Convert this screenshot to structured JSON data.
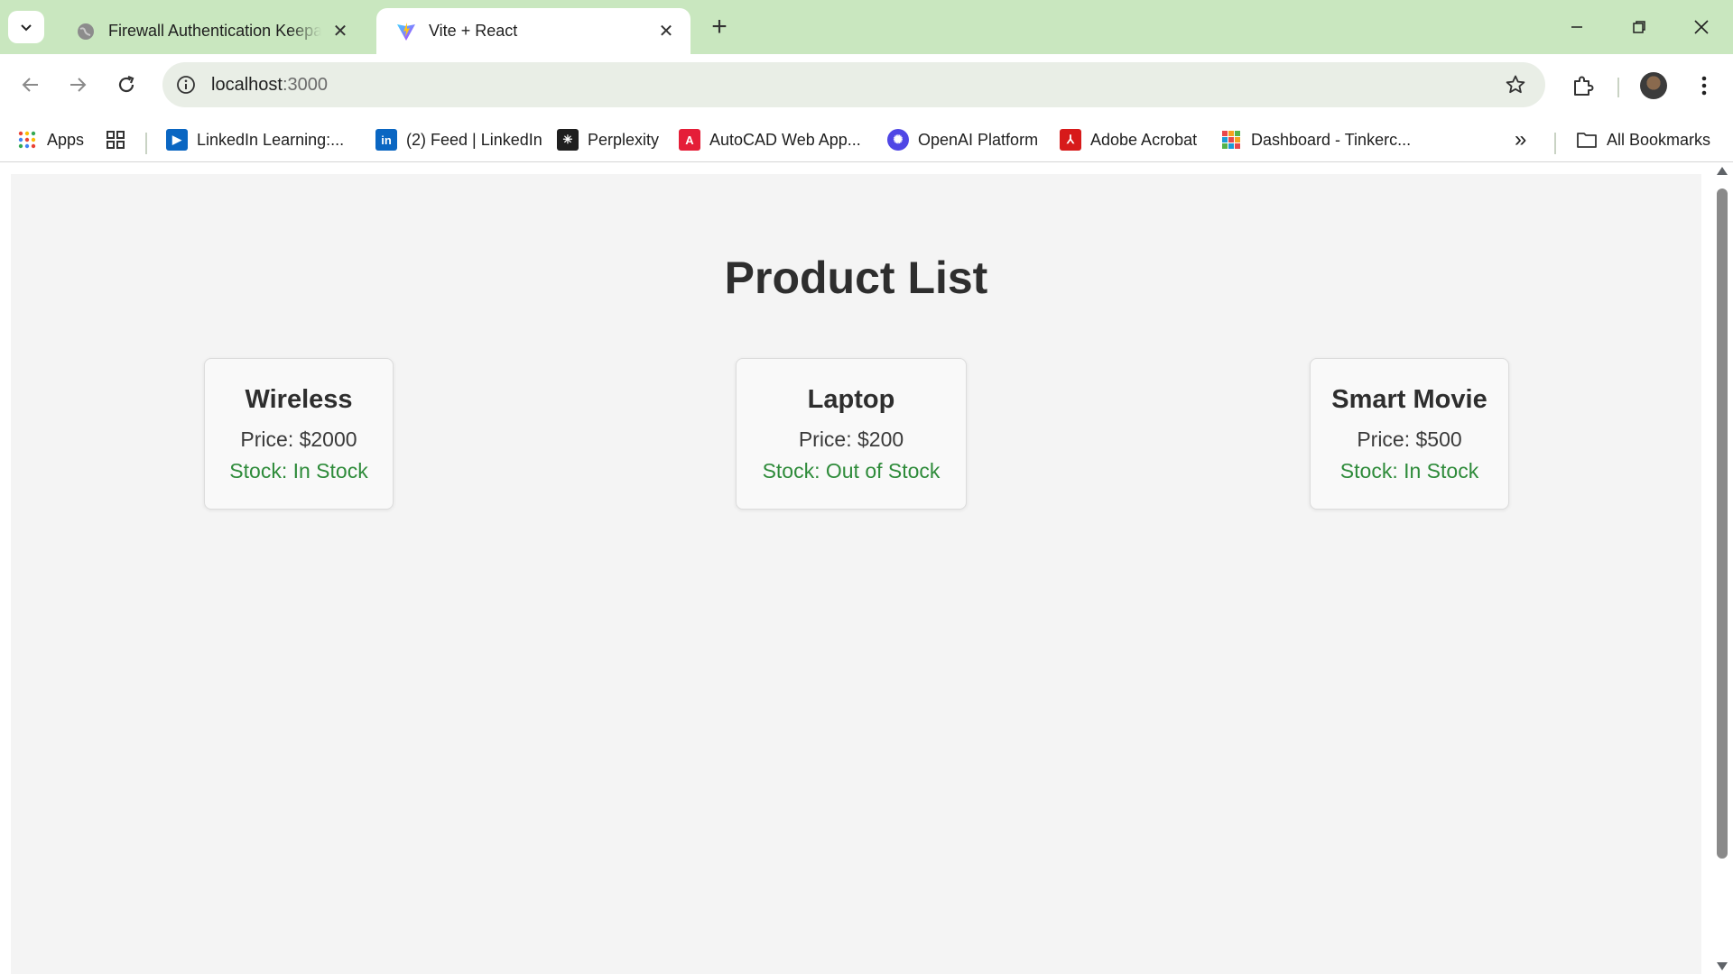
{
  "browser": {
    "tabs": [
      {
        "title": "Firewall Authentication Keepaliv",
        "icon": "globe-icon",
        "active": false
      },
      {
        "title": "Vite + React",
        "icon": "vite-logo-icon",
        "active": true
      }
    ],
    "address": {
      "host": "localhost",
      "port": ":3000"
    },
    "bookmarks": [
      {
        "label": "Apps",
        "icon": "apps-grid-icon"
      },
      {
        "label": "",
        "icon": "tab-groups-icon"
      },
      {
        "label": "LinkedIn Learning:...",
        "icon": "linkedin-learning-icon"
      },
      {
        "label": "(2) Feed | LinkedIn",
        "icon": "linkedin-icon"
      },
      {
        "label": "Perplexity",
        "icon": "perplexity-icon"
      },
      {
        "label": "AutoCAD Web App...",
        "icon": "autocad-icon"
      },
      {
        "label": "OpenAI Platform",
        "icon": "openai-icon"
      },
      {
        "label": "Adobe Acrobat",
        "icon": "acrobat-icon"
      },
      {
        "label": "Dashboard - Tinkerc...",
        "icon": "tinkercad-icon"
      }
    ],
    "overflow_label": "»",
    "all_bookmarks": "All Bookmarks"
  },
  "page": {
    "title": "Product List",
    "products": [
      {
        "name": "Wireless",
        "price": "Price: $2000",
        "stock": "Stock: In Stock"
      },
      {
        "name": "Laptop",
        "price": "Price: $200",
        "stock": "Stock: Out of Stock"
      },
      {
        "name": "Smart Movie",
        "price": "Price: $500",
        "stock": "Stock: In Stock"
      }
    ]
  },
  "colors": {
    "tabstrip": "#c9e7bf",
    "stock_text": "#2e8b3a",
    "page_bg": "#f4f4f4"
  }
}
